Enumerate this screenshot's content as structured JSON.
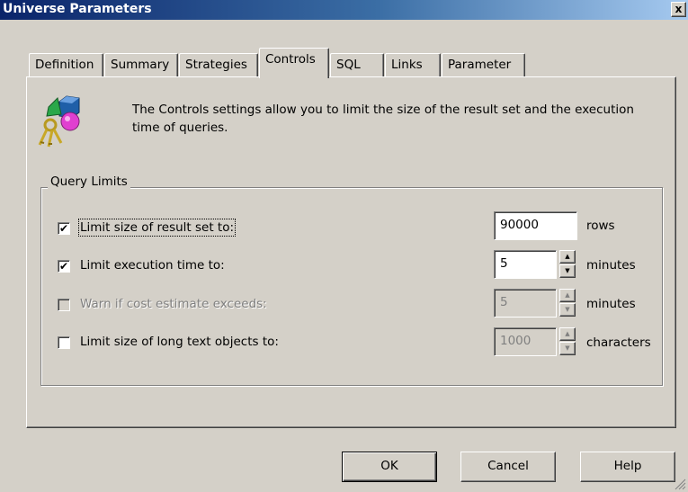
{
  "window": {
    "title": "Universe Parameters",
    "close_glyph": "x"
  },
  "tabs": [
    {
      "label": "Definition",
      "active": false
    },
    {
      "label": "Summary",
      "active": false
    },
    {
      "label": "Strategies",
      "active": false
    },
    {
      "label": "Controls",
      "active": true
    },
    {
      "label": "SQL",
      "active": false
    },
    {
      "label": "Links",
      "active": false
    },
    {
      "label": "Parameter",
      "active": false
    }
  ],
  "description": "The Controls settings allow you to limit the size of the result set and the execution time of queries.",
  "logo_icon": "keys-and-shapes-icon",
  "query_limits": {
    "legend": "Query Limits",
    "rows": [
      {
        "label": "Limit size of result set to:",
        "checked": true,
        "enabled": true,
        "value": "90000",
        "unit": "rows",
        "spinner": false
      },
      {
        "label": "Limit execution time to:",
        "checked": true,
        "enabled": true,
        "value": "5",
        "unit": "minutes",
        "spinner": true
      },
      {
        "label": "Warn if cost estimate exceeds:",
        "checked": false,
        "enabled": false,
        "value": "5",
        "unit": "minutes",
        "spinner": true
      },
      {
        "label": "Limit size of long text objects to:",
        "checked": false,
        "enabled": true,
        "value": "1000",
        "unit": "characters",
        "spinner": true
      }
    ]
  },
  "buttons": {
    "ok": "OK",
    "cancel": "Cancel",
    "help": "Help"
  },
  "check_glyph": "✔",
  "spin_up_glyph": "▲",
  "spin_down_glyph": "▼",
  "colors": {
    "dialog_face": "#d4d0c8",
    "title_start": "#0a246a",
    "title_end": "#a6caf0",
    "disabled_text": "#808080"
  }
}
